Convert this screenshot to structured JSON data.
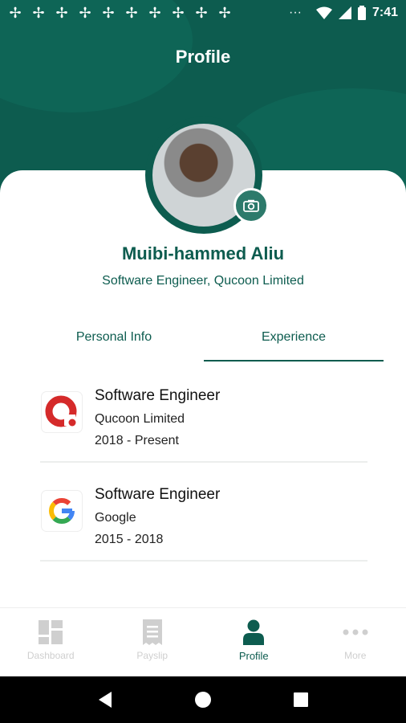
{
  "status_bar": {
    "time": "7:41",
    "notification_icons": [
      "pinwheel-icon",
      "pinwheel-icon",
      "pinwheel-icon",
      "pinwheel-icon",
      "pinwheel-icon",
      "pinwheel-icon",
      "pinwheel-icon",
      "pinwheel-icon",
      "pinwheel-icon",
      "pinwheel-icon"
    ],
    "overflow": "···"
  },
  "header": {
    "title": "Profile"
  },
  "profile": {
    "name": "Muibi-hammed Aliu",
    "role": "Software Engineer, Qucoon Limited"
  },
  "tabs": [
    {
      "label": "Personal Info",
      "active": false
    },
    {
      "label": "Experience",
      "active": true
    }
  ],
  "experience": [
    {
      "title": "Software Engineer",
      "company": "Qucoon Limited",
      "period": "2018 - Present",
      "logo": "qucoon-logo"
    },
    {
      "title": "Software Engineer",
      "company": "Google",
      "period": "2015 - 2018",
      "logo": "google-logo"
    }
  ],
  "bottom_nav": [
    {
      "label": "Dashboard",
      "icon": "dashboard-icon",
      "active": false
    },
    {
      "label": "Payslip",
      "icon": "payslip-icon",
      "active": false
    },
    {
      "label": "Profile",
      "icon": "profile-icon",
      "active": true
    },
    {
      "label": "More",
      "icon": "more-icon",
      "active": false
    }
  ],
  "colors": {
    "brand": "#0d5c4f",
    "inactive": "#cfcfcf"
  }
}
